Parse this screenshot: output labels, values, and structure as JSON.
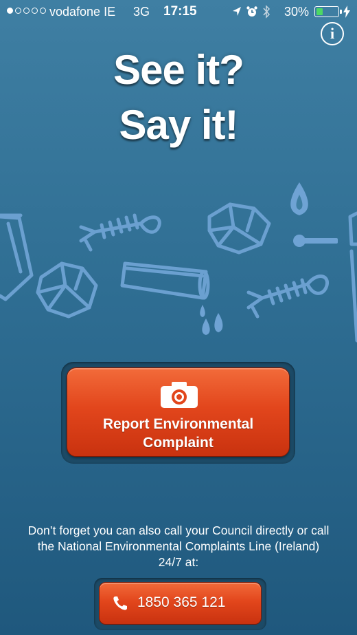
{
  "status_bar": {
    "signal_dots_filled": 1,
    "signal_dots_total": 5,
    "carrier": "vodafone IE",
    "network": "3G",
    "time": "17:15",
    "battery_percent": "30%",
    "battery_level": 0.3,
    "icons": [
      "location-arrow-icon",
      "alarm-icon",
      "bluetooth-icon",
      "charging-bolt-icon"
    ]
  },
  "header": {
    "info_icon": "i"
  },
  "headline": {
    "line1": "See it?",
    "line2": "Say it!"
  },
  "illustration": {
    "icons": [
      "bin-icon",
      "fish-bone-icon",
      "crumpled-paper-icon",
      "pipe-drip-icon",
      "flame-match-icon",
      "fish-bone-icon",
      "tap-icon"
    ]
  },
  "report_button": {
    "label": "Report Environmental Complaint",
    "icon": "camera-icon"
  },
  "note": {
    "text": "Don’t forget you can also call your Council directly or call the National Environmental Complaints Line (Ireland) 24/7 at:"
  },
  "call_button": {
    "number": "1850 365 121",
    "icon": "phone-icon"
  },
  "colors": {
    "background_top": "#3f7fa3",
    "background_bottom": "#1f587d",
    "button_orange": "#e2461c",
    "illustration_blue": "#6fa3d4",
    "battery_green": "#4cd964"
  }
}
